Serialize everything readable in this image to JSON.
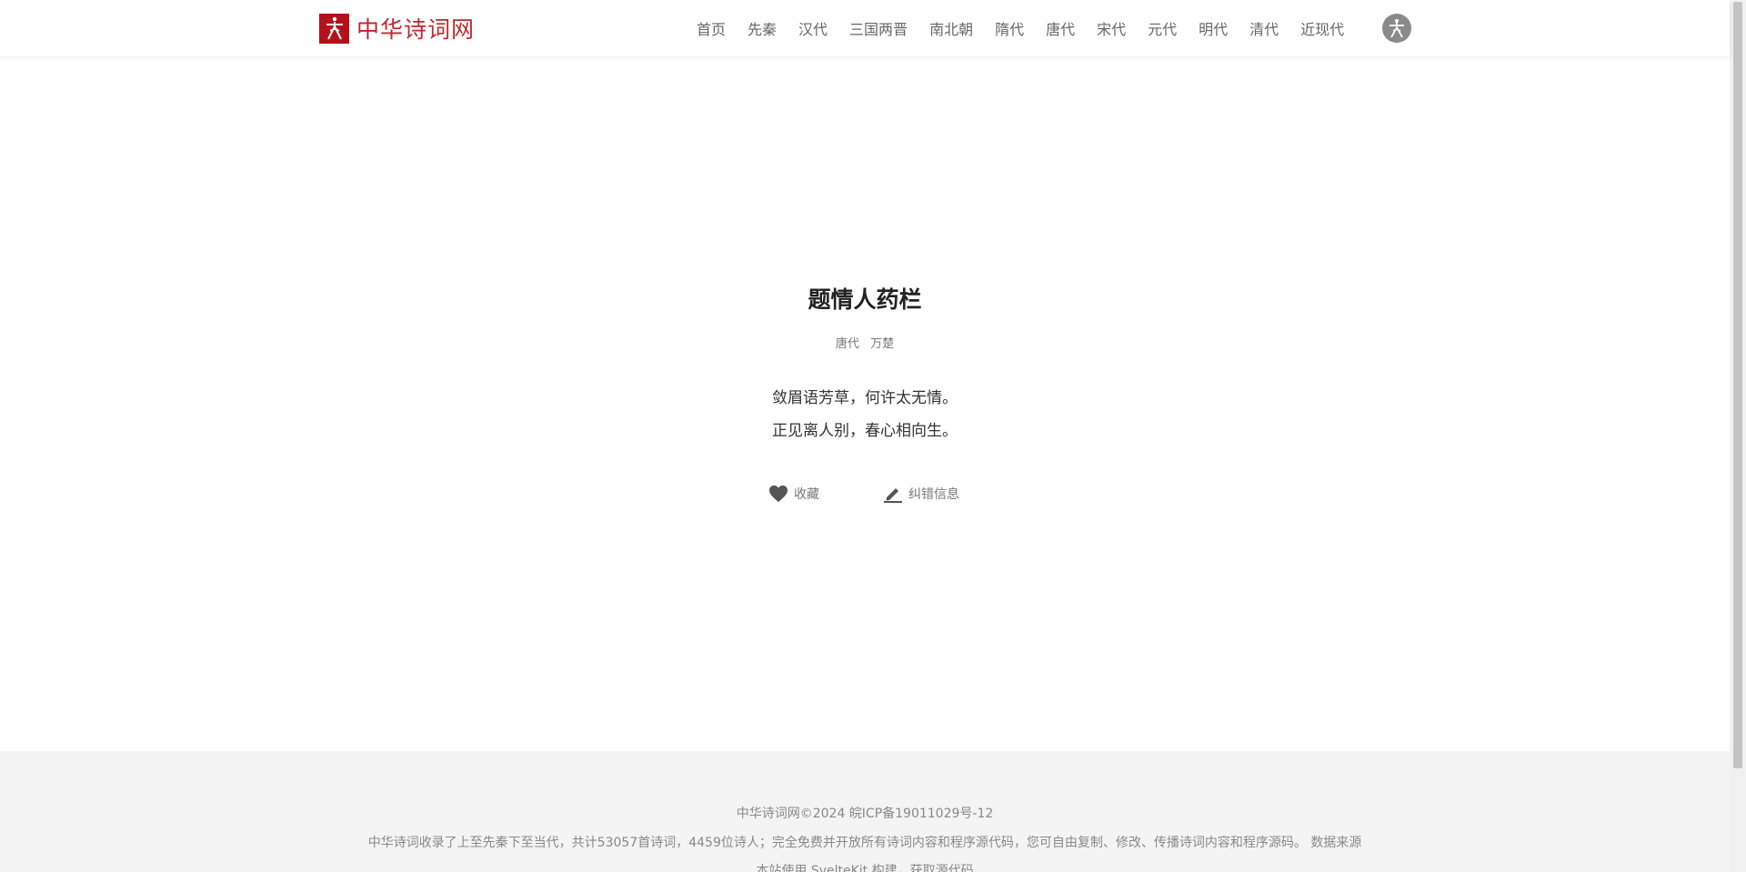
{
  "header": {
    "logo_text": "中华诗词网",
    "nav": [
      "首页",
      "先秦",
      "汉代",
      "三国两晋",
      "南北朝",
      "隋代",
      "唐代",
      "宋代",
      "元代",
      "明代",
      "清代",
      "近现代"
    ]
  },
  "poem": {
    "title": "题情人药栏",
    "dynasty": "唐代",
    "author": "万楚",
    "lines": [
      "敛眉语芳草，何许太无情。",
      "正见离人别，春心相向生。"
    ]
  },
  "actions": {
    "favorite_label": "收藏",
    "favorite_icon": "heart-icon",
    "report_label": "纠错信息",
    "report_icon": "pencil-icon"
  },
  "footer": {
    "line1": "中华诗词网©2024 皖ICP备19011029号-12",
    "line2_text": "中华诗词收录了上至先秦下至当代，共计53057首诗词，4459位诗人；完全免费并开放所有诗词内容和程序源代码，您可自由复制、修改、传播诗词内容和程序源码。",
    "line2_link": "数据来源",
    "line3": "本站使用 SvelteKit 构建，获取源代码"
  },
  "colors": {
    "brand": "#b4121a",
    "brand_text": "#c2262d",
    "footer_bg": "#f4f4f4"
  }
}
